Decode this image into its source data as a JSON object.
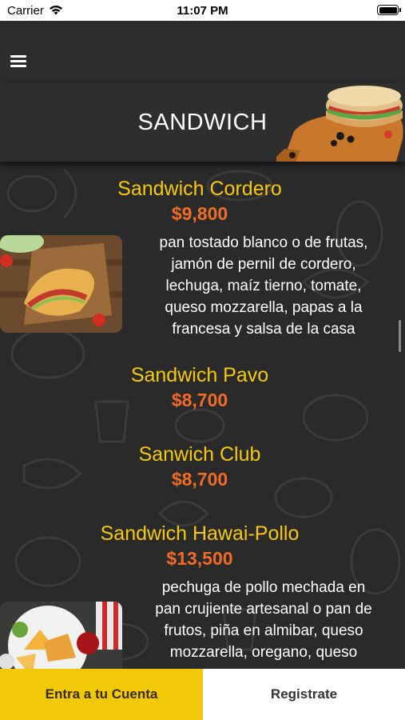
{
  "status_bar": {
    "carrier": "Carrier",
    "time": "11:07 PM"
  },
  "header": {
    "title": "SANDWICH"
  },
  "menu_items": [
    {
      "name": "Sandwich Cordero",
      "price": "$9,800",
      "description_lines": [
        "pan tostado blanco o de frutas,",
        "jamón de pernil de cordero,",
        "lechuga, maíz tierno, tomate,",
        "queso mozzarella, papas a la",
        "francesa y salsa de la casa"
      ]
    },
    {
      "name": "Sandwich Pavo",
      "price": "$8,700"
    },
    {
      "name": "Sanwich Club",
      "price": "$8,700"
    },
    {
      "name": "Sandwich Hawai-Pollo",
      "price": "$13,500",
      "description_lines": [
        "pechuga de pollo mechada en",
        "pan crujiente artesanal o pan de",
        "frutos, piña en almibar, queso",
        "mozzarella, oregano, queso"
      ]
    }
  ],
  "footer": {
    "login_label": "Entra a tu Cuenta",
    "register_label": "Registrate"
  },
  "colors": {
    "accent_yellow": "#f5c90c",
    "price_orange": "#f06b23",
    "background": "#2c2c2d"
  }
}
